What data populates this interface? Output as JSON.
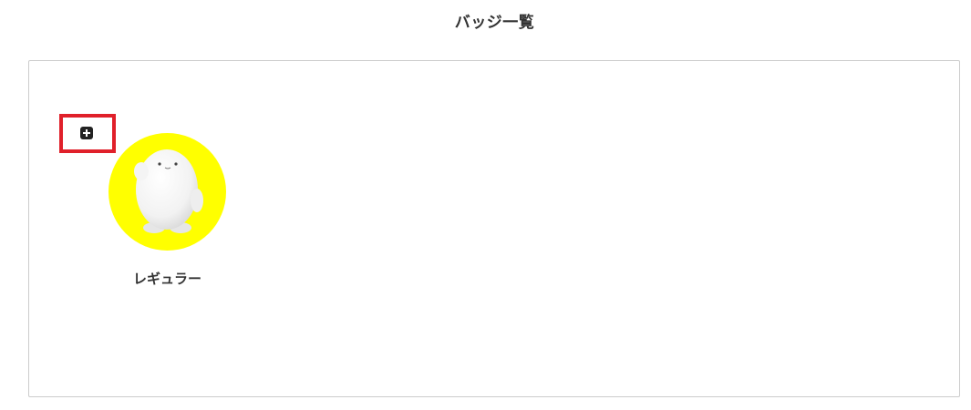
{
  "page": {
    "title": "バッジ一覧"
  },
  "toolbar": {
    "add_icon": "plus-square-icon"
  },
  "badges": [
    {
      "label": "レギュラー",
      "background_color": "#ffff00",
      "mascot_icon": "white-mascot-icon"
    }
  ],
  "colors": {
    "highlight": "#e0202a",
    "badge_background": "#ffff00",
    "panel_border": "#cccccc"
  }
}
